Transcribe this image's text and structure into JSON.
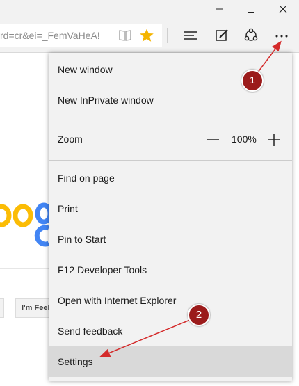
{
  "window": {
    "minimize_icon": "minimize-icon",
    "maximize_icon": "maximize-icon",
    "close_icon": "close-icon"
  },
  "toolbar": {
    "address_text": "rd=cr&ei=_FemVaHeA!",
    "icons": [
      "reading-view-icon",
      "favorite-star-icon",
      "hub-icon",
      "web-note-icon",
      "share-icon",
      "more-actions-icon"
    ]
  },
  "page": {
    "button_partial": "I'm Feel"
  },
  "menu": {
    "new_window": "New window",
    "new_inprivate_window": "New InPrivate window",
    "zoom_label": "Zoom",
    "zoom_value": "100%",
    "find_on_page": "Find on page",
    "print": "Print",
    "pin_to_start": "Pin to Start",
    "f12_tools": "F12 Developer Tools",
    "open_with_ie": "Open with Internet Explorer",
    "send_feedback": "Send feedback",
    "settings": "Settings"
  },
  "annotations": {
    "badge1": "1",
    "badge2": "2"
  },
  "colors": {
    "toolbar_bg": "#f2f2f2",
    "menu_bg": "#f2f2f2",
    "menu_highlight": "#d9d9d9",
    "badge": "#9b1b1b",
    "arrow": "#d42a2a",
    "star": "#f4b400"
  }
}
